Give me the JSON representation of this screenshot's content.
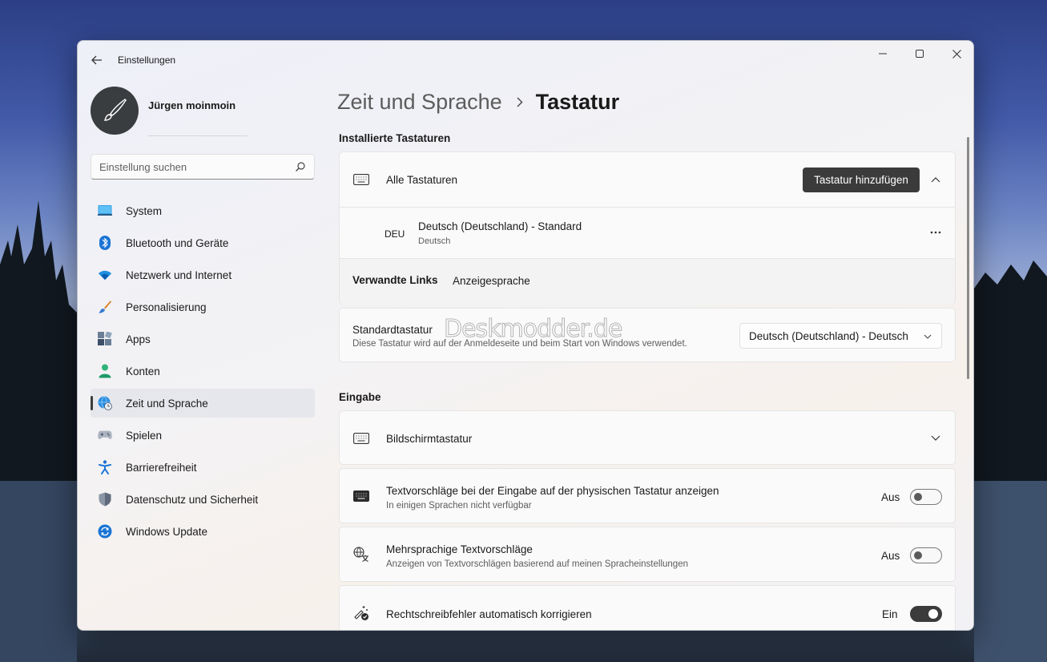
{
  "window": {
    "app_title": "Einstellungen"
  },
  "user": {
    "name": "Jürgen moinmoin"
  },
  "search": {
    "placeholder": "Einstellung suchen"
  },
  "sidebar": {
    "items": [
      {
        "label": "System",
        "icon": "monitor-icon"
      },
      {
        "label": "Bluetooth und Geräte",
        "icon": "bluetooth-icon"
      },
      {
        "label": "Netzwerk und Internet",
        "icon": "wifi-icon"
      },
      {
        "label": "Personalisierung",
        "icon": "brush-icon"
      },
      {
        "label": "Apps",
        "icon": "apps-icon"
      },
      {
        "label": "Konten",
        "icon": "person-icon"
      },
      {
        "label": "Zeit und Sprache",
        "icon": "globe-clock-icon",
        "active": true
      },
      {
        "label": "Spielen",
        "icon": "gamepad-icon"
      },
      {
        "label": "Barrierefreiheit",
        "icon": "accessibility-icon"
      },
      {
        "label": "Datenschutz und Sicherheit",
        "icon": "shield-icon"
      },
      {
        "label": "Windows Update",
        "icon": "update-icon"
      }
    ]
  },
  "breadcrumb": {
    "parent": "Zeit und Sprache",
    "current": "Tastatur"
  },
  "installed": {
    "section_title": "Installierte Tastaturen",
    "all_keyboards_label": "Alle Tastaturen",
    "add_button": "Tastatur hinzufügen",
    "keyboard": {
      "code": "DEU",
      "name": "Deutsch (Deutschland)  - Standard",
      "language": "Deutsch"
    },
    "related_links_label": "Verwandte Links",
    "related_link": "Anzeigesprache"
  },
  "default_keyboard": {
    "title": "Standardtastatur",
    "description": "Diese Tastatur wird auf der Anmeldeseite und beim Start von Windows verwendet.",
    "selected": "Deutsch (Deutschland) - Deutsch"
  },
  "input": {
    "section_title": "Eingabe",
    "touch_keyboard": "Bildschirmtastatur",
    "text_suggestions": {
      "title": "Textvorschläge bei der Eingabe auf der physischen Tastatur anzeigen",
      "description": "In einigen Sprachen nicht verfügbar",
      "state": "Aus",
      "on": false
    },
    "multilingual": {
      "title": "Mehrsprachige Textvorschläge",
      "description": "Anzeigen von Textvorschlägen basierend auf meinen Spracheinstellungen",
      "state": "Aus",
      "on": false
    },
    "autocorrect": {
      "title": "Rechtschreibfehler automatisch korrigieren",
      "state": "Ein",
      "on": true
    }
  },
  "watermark": "Deskmodder.de",
  "colors": {
    "accent_dark": "#3b3b3b",
    "windows_blue": "#0067c0"
  }
}
